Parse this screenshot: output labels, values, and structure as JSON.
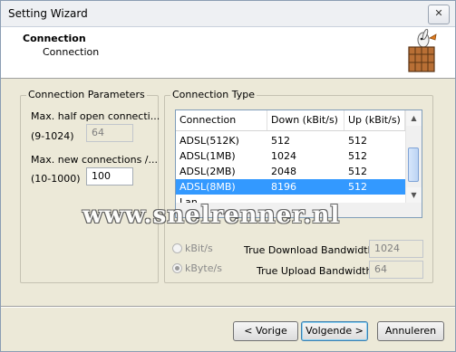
{
  "window": {
    "title": "Setting Wizard",
    "close_symbol": "✕"
  },
  "header": {
    "title": "Connection",
    "subtitle": "Connection",
    "logo_icon": "box-rabbit-icon"
  },
  "params": {
    "group_label": "Connection Parameters",
    "half_open_label": "Max. half open connecti...",
    "half_open_range": "(9-1024)",
    "half_open_value": "64",
    "new_conn_label": "Max. new connections /...",
    "new_conn_range": "(10-1000)",
    "new_conn_value": "100"
  },
  "conn_type": {
    "group_label": "Connection Type",
    "columns": [
      "Connection",
      "Down (kBit/s)",
      "Up (kBit/s)"
    ],
    "rows": [
      [
        "ADSL(512K)",
        "512",
        "512"
      ],
      [
        "ADSL(1MB)",
        "1024",
        "512"
      ],
      [
        "ADSL(2MB)",
        "2048",
        "512"
      ],
      [
        "ADSL(8MB)",
        "8196",
        "512"
      ],
      [
        "Lan",
        "",
        ""
      ]
    ],
    "selected_row": 3,
    "scroll_up": "▲",
    "scroll_down": "▼"
  },
  "units": {
    "kbit_label": "kBit/s",
    "kbyte_label": "kByte/s",
    "selected": "kByte/s"
  },
  "bandwidth": {
    "download_label": "True Download Bandwidth",
    "download_value": "1024",
    "upload_label": "True Upload Bandwidth",
    "upload_value": "64"
  },
  "buttons": {
    "back": "< Vorige",
    "next": "Volgende >",
    "cancel": "Annuleren"
  },
  "watermark": "www.snelrenner.nl",
  "colors": {
    "selection": "#3399ff",
    "dialog_bg": "#ece9d8"
  }
}
